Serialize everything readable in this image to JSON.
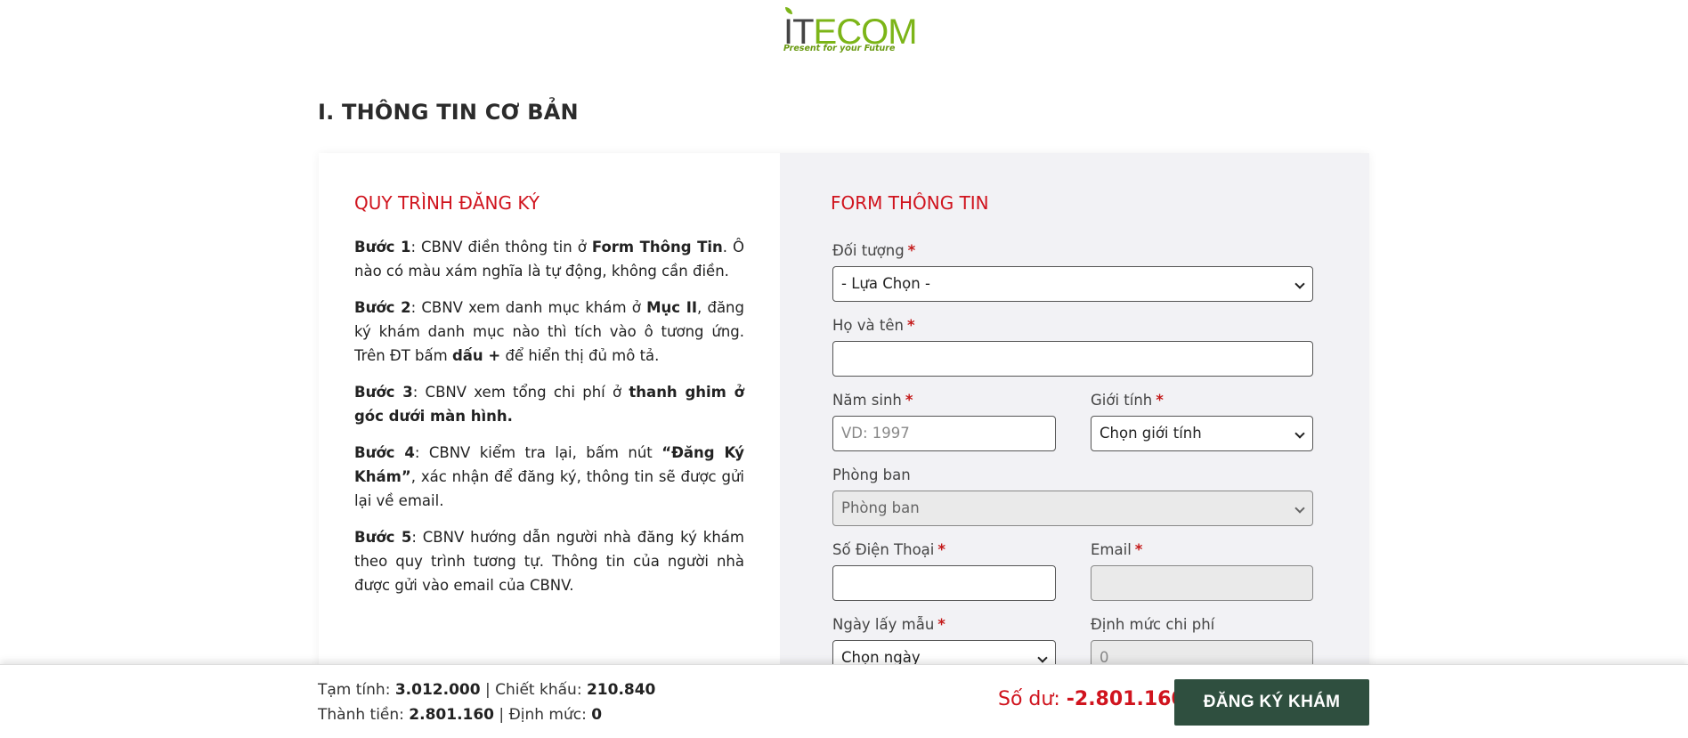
{
  "logo": {
    "name_part1": "IT",
    "name_part2": "ECOM",
    "tagline": "Present for your Future"
  },
  "section_title": "I. THÔNG TIN CƠ BẢN",
  "process": {
    "title": "QUY TRÌNH ĐĂNG KÝ",
    "steps": [
      {
        "label": "Bước 1",
        "parts": [
          ": CBNV điền thông tin ở ",
          "Form Thông Tin",
          ". Ô nào có màu xám nghĩa là tự động, không cần điền."
        ]
      },
      {
        "label": "Bước 2",
        "parts": [
          ": CBNV xem danh mục khám ở ",
          "Mục II",
          ", đăng ký khám danh mục nào thì tích vào ô tương ứng. Trên ĐT bấm ",
          "dấu +",
          " để hiển thị đủ mô tả."
        ]
      },
      {
        "label": "Bước 3",
        "parts": [
          ": CBNV xem tổng chi phí ở ",
          "thanh ghim ở góc dưới màn hình."
        ]
      },
      {
        "label": "Bước 4",
        "parts": [
          ": CBNV kiểm tra lại, bấm nút ",
          "“Đăng Ký Khám”",
          ", xác nhận để đăng ký, thông tin sẽ được gửi lại về email."
        ]
      },
      {
        "label": "Bước 5",
        "parts": [
          ": CBNV hướng dẫn người nhà đăng ký khám theo quy trình tương tự. Thông tin của người nhà được gửi vào email của CBNV."
        ]
      }
    ]
  },
  "form": {
    "title": "FORM THÔNG TIN",
    "required_mark": "*",
    "doi_tuong": {
      "label": "Đối tượng",
      "value": "- Lựa Chọn -"
    },
    "ho_ten": {
      "label": "Họ và tên",
      "value": ""
    },
    "nam_sinh": {
      "label": "Năm sinh",
      "placeholder": "VD: 1997"
    },
    "gioi_tinh": {
      "label": "Giới tính",
      "value": "Chọn giới tính"
    },
    "phong_ban": {
      "label": "Phòng ban",
      "value": "Phòng ban"
    },
    "so_dien_thoai": {
      "label": "Số Điện Thoại",
      "value": ""
    },
    "email": {
      "label": "Email",
      "value": ""
    },
    "ngay_lay_mau": {
      "label": "Ngày lấy mẫu",
      "value": "Chọn ngày"
    },
    "dinh_muc_chi_phi": {
      "label": "Định mức chi phí",
      "value": "0"
    }
  },
  "summary": {
    "tam_tinh_label": "Tạm tính:",
    "tam_tinh_value": "3.012.000",
    "chiet_khau_label": "Chiết khấu:",
    "chiet_khau_value": "210.840",
    "thanh_tien_label": "Thành tiền:",
    "thanh_tien_value": "2.801.160",
    "dinh_muc_label": "Định mức:",
    "dinh_muc_value": "0",
    "separator": "|",
    "so_du_label": "Số dư:",
    "so_du_value": "-2.801.160",
    "submit_label": "ĐĂNG KÝ KHÁM"
  },
  "colors": {
    "accent_red": "#d0141e",
    "button_green": "#2f4f3f",
    "logo_green": "#7cb518"
  }
}
